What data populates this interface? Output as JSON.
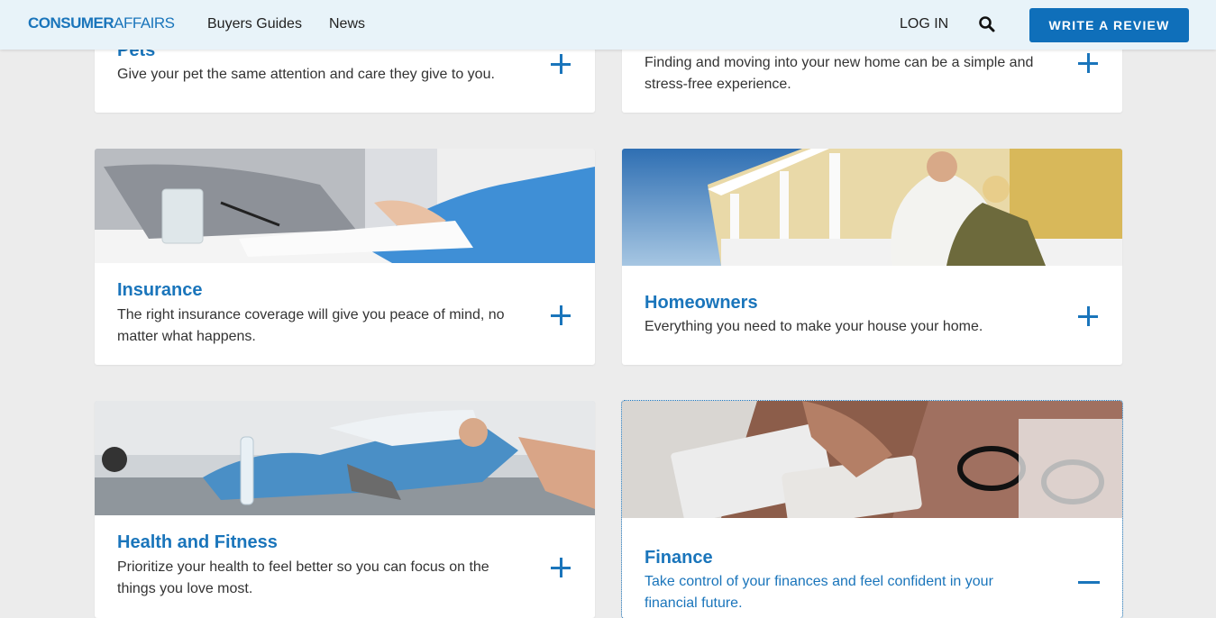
{
  "nav": {
    "logo_bold": "CONSUMER",
    "logo_light": "AFFAIRS",
    "links": [
      "Buyers Guides",
      "News"
    ],
    "login": "LOG IN",
    "write_review": "WRITE A REVIEW"
  },
  "cards": {
    "pets": {
      "title": "Pets",
      "desc": "Give your pet the same attention and care they give to you."
    },
    "moving": {
      "title": "",
      "desc": "Finding and moving into your new home can be a simple and stress-free experience."
    },
    "insurance": {
      "title": "Insurance",
      "desc": "The right insurance coverage will give you peace of mind, no matter what happens."
    },
    "homeowners": {
      "title": "Homeowners",
      "desc": "Everything you need to make your house your home."
    },
    "health": {
      "title": "Health and Fitness",
      "desc": "Prioritize your health to feel better so you can focus on the things you love most."
    },
    "finance": {
      "title": "Finance",
      "desc": "Take control of your finances and feel confident in your financial future.",
      "expanded": true
    }
  },
  "colors": {
    "accent": "#1a75bb",
    "button": "#0f6fba",
    "nav_bg": "#e8f3f9",
    "page_bg": "#ececec"
  }
}
